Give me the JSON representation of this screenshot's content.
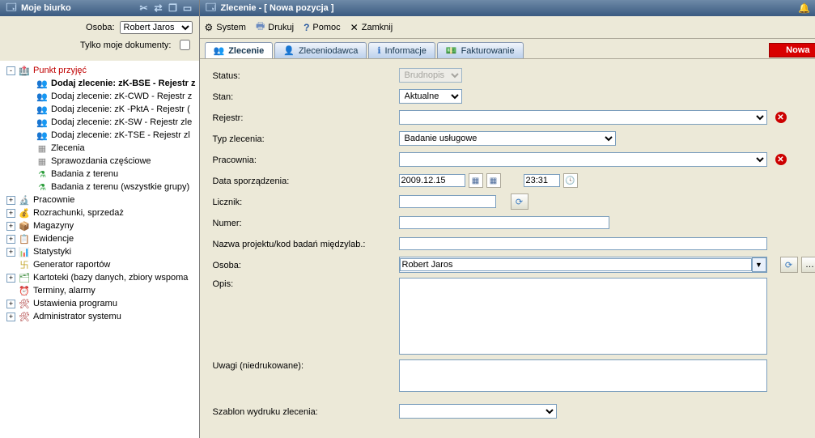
{
  "left": {
    "title": "Moje biurko",
    "filter_osoba_label": "Osoba:",
    "filter_osoba_value": "Robert Jaros",
    "filter_only_mine_label": "Tylko moje dokumenty:",
    "tree": [
      {
        "indent": 0,
        "exp": "-",
        "icon": "🏥",
        "iconColor": "#d07000",
        "label": "Punkt przyjęć",
        "cls": "red"
      },
      {
        "indent": 1,
        "exp": "",
        "icon": "👥",
        "iconColor": "#d07000",
        "label": "Dodaj zlecenie: zK-BSE - Rejestr z",
        "cls": "bold"
      },
      {
        "indent": 1,
        "exp": "",
        "icon": "👥",
        "iconColor": "#d07000",
        "label": "Dodaj zlecenie: zK-CWD - Rejestr z",
        "cls": ""
      },
      {
        "indent": 1,
        "exp": "",
        "icon": "👥",
        "iconColor": "#d07000",
        "label": "Dodaj zlecenie: zK -PktA - Rejestr (",
        "cls": ""
      },
      {
        "indent": 1,
        "exp": "",
        "icon": "👥",
        "iconColor": "#d07000",
        "label": "Dodaj zlecenie: zK-SW - Rejestr zle",
        "cls": ""
      },
      {
        "indent": 1,
        "exp": "",
        "icon": "👥",
        "iconColor": "#d07000",
        "label": "Dodaj zlecenie: zK-TSE - Rejestr zl",
        "cls": ""
      },
      {
        "indent": 1,
        "exp": "",
        "icon": "▦",
        "iconColor": "#888",
        "label": "Zlecenia",
        "cls": ""
      },
      {
        "indent": 1,
        "exp": "",
        "icon": "▦",
        "iconColor": "#888",
        "label": "Sprawozdania częściowe",
        "cls": ""
      },
      {
        "indent": 1,
        "exp": "",
        "icon": "⚗",
        "iconColor": "#2a9d3a",
        "label": "Badania z terenu",
        "cls": ""
      },
      {
        "indent": 1,
        "exp": "",
        "icon": "⚗",
        "iconColor": "#2a9d3a",
        "label": "Badania z terenu (wszystkie grupy)",
        "cls": ""
      },
      {
        "indent": 0,
        "exp": "+",
        "icon": "🔬",
        "iconColor": "#444",
        "label": "Pracownie",
        "cls": ""
      },
      {
        "indent": 0,
        "exp": "+",
        "icon": "💰",
        "iconColor": "#c0a020",
        "label": "Rozrachunki, sprzedaż",
        "cls": ""
      },
      {
        "indent": 0,
        "exp": "+",
        "icon": "📦",
        "iconColor": "#8a6a30",
        "label": "Magazyny",
        "cls": ""
      },
      {
        "indent": 0,
        "exp": "+",
        "icon": "📋",
        "iconColor": "#6080b0",
        "label": "Ewidencje",
        "cls": ""
      },
      {
        "indent": 0,
        "exp": "+",
        "icon": "📊",
        "iconColor": "#555",
        "label": "Statystyki",
        "cls": ""
      },
      {
        "indent": 0,
        "exp": "",
        "icon": "卐",
        "iconColor": "#c0a020",
        "label": "Generator raportów",
        "cls": ""
      },
      {
        "indent": 0,
        "exp": "+",
        "icon": "🗂",
        "iconColor": "#3a8a3a",
        "label": "Kartoteki (bazy danych, zbiory wspoma",
        "cls": ""
      },
      {
        "indent": 0,
        "exp": "",
        "icon": "⏰",
        "iconColor": "#a02020",
        "label": "Terminy, alarmy",
        "cls": ""
      },
      {
        "indent": 0,
        "exp": "+",
        "icon": "🛠",
        "iconColor": "#a02020",
        "label": "Ustawienia programu",
        "cls": ""
      },
      {
        "indent": 0,
        "exp": "+",
        "icon": "🛠",
        "iconColor": "#a02020",
        "label": "Administrator systemu",
        "cls": ""
      }
    ]
  },
  "right": {
    "title": "Zlecenie - [ Nowa pozycja ]",
    "menu": {
      "system": "System",
      "drukuj": "Drukuj",
      "pomoc": "Pomoc",
      "zamknij": "Zamknij"
    },
    "tabs": {
      "zlecenie": "Zlecenie",
      "zleceniodawca": "Zleceniodawca",
      "informacje": "Informacje",
      "fakturowanie": "Fakturowanie"
    },
    "nowa": "Nowa",
    "form": {
      "status_label": "Status:",
      "status_value": "Brudnopis",
      "stan_label": "Stan:",
      "stan_value": "Aktualne",
      "rejestr_label": "Rejestr:",
      "rejestr_value": "",
      "typ_label": "Typ zlecenia:",
      "typ_value": "Badanie usługowe",
      "pracownia_label": "Pracownia:",
      "pracownia_value": "",
      "data_label": "Data sporządzenia:",
      "data_value": "2009.12.15",
      "time_value": "23:31",
      "licznik_label": "Licznik:",
      "licznik_value": "",
      "numer_label": "Numer:",
      "numer_value": "",
      "nazwa_label": "Nazwa projektu/kod badań międzylab.:",
      "nazwa_value": "",
      "osoba_label": "Osoba:",
      "osoba_value": "Robert Jaros",
      "opis_label": "Opis:",
      "opis_value": "",
      "uwagi_label": "Uwagi (niedrukowane):",
      "uwagi_value": "",
      "szablon_label": "Szablon wydruku zlecenia:",
      "szablon_value": ""
    }
  }
}
